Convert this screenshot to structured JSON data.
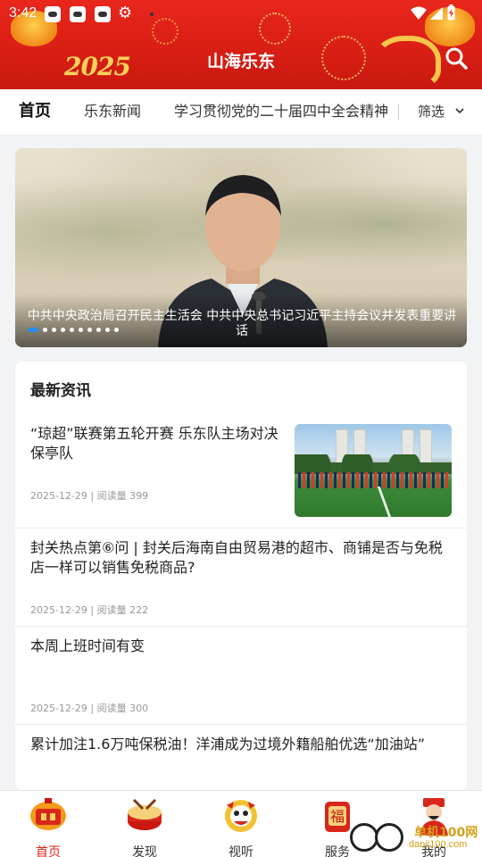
{
  "status_bar": {
    "time": "3:42"
  },
  "header": {
    "year_art": "2025",
    "title": "山海乐东"
  },
  "tabs": [
    {
      "label": "首页",
      "active": true
    },
    {
      "label": "乐东新闻",
      "active": false
    },
    {
      "label": "学习贯彻党的二十届四中全会精神",
      "active": false
    }
  ],
  "filter": {
    "label": "筛选"
  },
  "banner": {
    "caption": "中共中央政治局召开民主生活会 中共中央总书记习近平主持会议并发表重要讲话",
    "slide_count": 10,
    "active_slide": 0
  },
  "news": {
    "heading": "最新资讯",
    "items": [
      {
        "title": "“琼超”联赛第五轮开赛 乐东队主场对决保亭队",
        "meta": "2025-12-29 | 阅读量 399",
        "has_thumb": true
      },
      {
        "title": "封关热点第⑥问 | 封关后海南自由贸易港的超市、商铺是否与免税店一样可以销售免税商品?",
        "meta": "2025-12-29 | 阅读量 222",
        "has_thumb": false
      },
      {
        "title": "本周上班时间有变",
        "meta": "2025-12-29 | 阅读量 300",
        "has_thumb": false
      },
      {
        "title": "累计加注1.6万吨保税油！洋浦成为过境外籍船舶优选“加油站”",
        "meta": "",
        "has_thumb": false
      }
    ]
  },
  "bottom_nav": [
    {
      "label": "首页",
      "icon": "home-lantern-icon",
      "active": true
    },
    {
      "label": "发现",
      "icon": "drum-icon",
      "active": false
    },
    {
      "label": "视听",
      "icon": "lion-dance-icon",
      "active": false
    },
    {
      "label": "服务",
      "icon": "fortune-bag-icon",
      "active": false
    },
    {
      "label": "我的",
      "icon": "god-of-wealth-icon",
      "active": false
    }
  ],
  "watermark": {
    "text": "单机100网",
    "url_text": "danji100.com"
  },
  "colors": {
    "brand_red": "#d81e14",
    "active_nav": "#e0241b",
    "dot_active": "#2d8cf0"
  }
}
